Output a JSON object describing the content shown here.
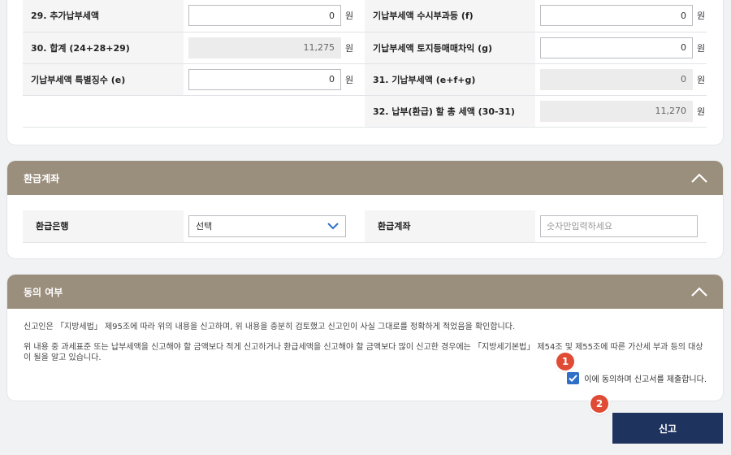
{
  "tax_rows": {
    "left": [
      {
        "label": "29. 추가납부세액",
        "value": "0",
        "unit": "원",
        "readonly": false
      },
      {
        "label": "30. 합계 (24+28+29)",
        "value": "11,275",
        "unit": "원",
        "readonly": true
      },
      {
        "label": "기납부세액 특별징수 (e)",
        "value": "0",
        "unit": "원",
        "readonly": false
      }
    ],
    "right": [
      {
        "label": "기납부세액 수시부과등 (f)",
        "value": "0",
        "unit": "원",
        "readonly": false
      },
      {
        "label": "기납부세액 토지등매매차익 (g)",
        "value": "0",
        "unit": "원",
        "readonly": false
      },
      {
        "label": "31. 기납부세액 (e+f+g)",
        "value": "0",
        "unit": "원",
        "readonly": true
      },
      {
        "label": "32. 납부(환급) 할 총 세액 (30-31)",
        "value": "11,270",
        "unit": "원",
        "readonly": true
      }
    ]
  },
  "refund": {
    "title": "환급계좌",
    "bank_label": "환급은행",
    "bank_value": "선택",
    "account_label": "환급계좌",
    "account_placeholder": "숫자만입력하세요"
  },
  "consent": {
    "title": "동의 여부",
    "text1": "신고인은 「지방세법」 제95조에 따라 위의 내용을 신고하며, 위 내용을 충분히 검토했고 신고인이 사실 그대로를 정확하게 적었음을 확인합니다.",
    "text2": "위 내용 중 과세표준 또는 납부세액을 신고해야 할 금액보다 적게 신고하거나 환급세액을 신고해야 할 금액보다 많이 신고한 경우에는 「지방세기본법」 제54조 및 제55조에 따른 가산세 부과 등의 대상이 될을 알고 있습니다.",
    "agree_label": "이에 동의하며 신고서를 제출합니다.",
    "agree_checked": true
  },
  "badges": [
    "1",
    "2"
  ],
  "submit_label": "신고",
  "colors": {
    "header": "#9a8e7c",
    "submit": "#1f335f",
    "checkbox": "#2f6fc8",
    "badge": "#e04b35"
  }
}
